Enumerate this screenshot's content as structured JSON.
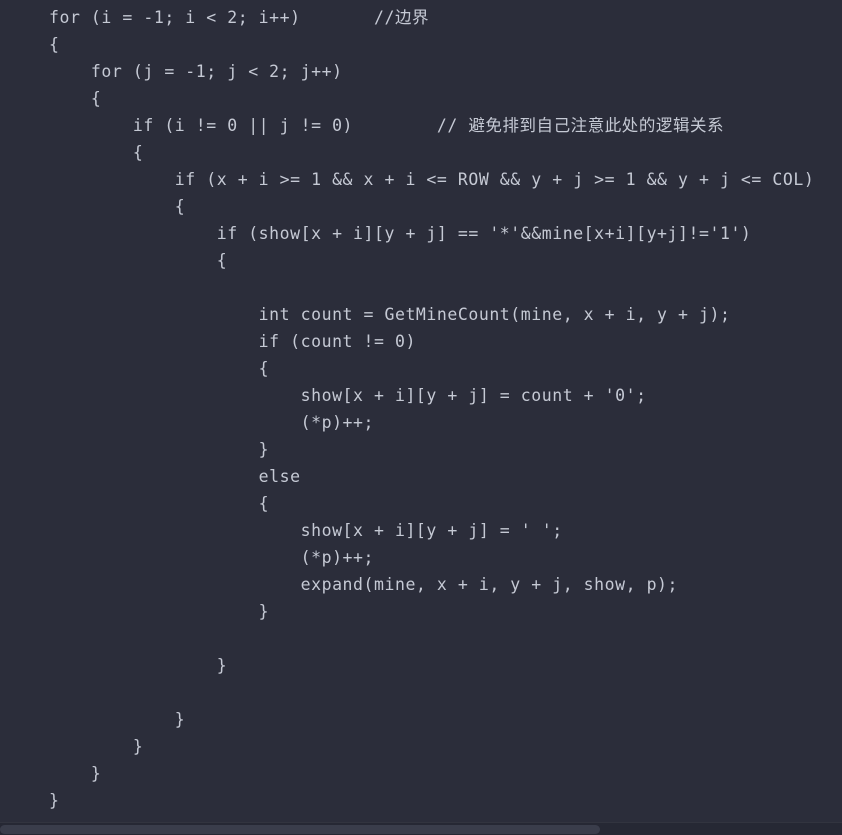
{
  "editor": {
    "background_color": "#2b2d3a",
    "text_color": "#c5c9d4",
    "language": "c",
    "scrollbar": {
      "orientation": "horizontal",
      "thumb_color": "#3a3d4b",
      "track_color": "#262834"
    }
  },
  "code": {
    "lines": [
      "for (i = -1; i < 2; i++)       //边界",
      "{",
      "    for (j = -1; j < 2; j++)",
      "    {",
      "        if (i != 0 || j != 0)        // 避免排到自己注意此处的逻辑关系",
      "        {",
      "            if (x + i >= 1 && x + i <= ROW && y + j >= 1 && y + j <= COL)",
      "            {",
      "                if (show[x + i][y + j] == '*'&&mine[x+i][y+j]!='1')",
      "                {",
      "",
      "                    int count = GetMineCount(mine, x + i, y + j);",
      "                    if (count != 0)",
      "                    {",
      "                        show[x + i][y + j] = count + '0';",
      "                        (*p)++;",
      "                    }",
      "                    else",
      "                    {",
      "                        show[x + i][y + j] = ' ';",
      "                        (*p)++;",
      "                        expand(mine, x + i, y + j, show, p);",
      "                    }",
      "",
      "                }",
      "",
      "            }",
      "        }",
      "    }",
      "}"
    ]
  }
}
